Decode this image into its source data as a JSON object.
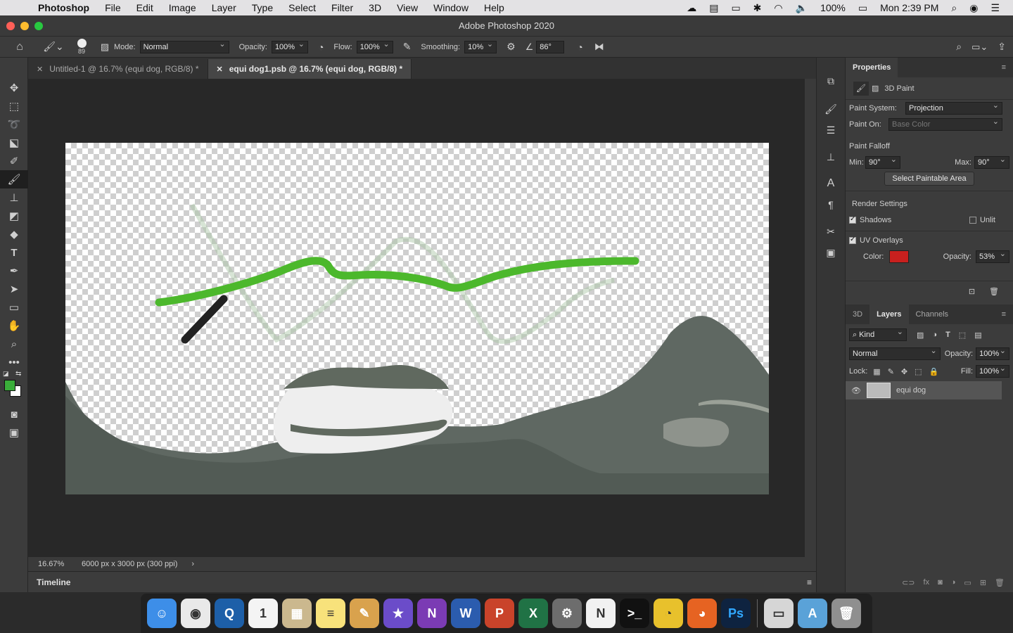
{
  "menubar": {
    "app_name": "Photoshop",
    "items": [
      "File",
      "Edit",
      "Image",
      "Layer",
      "Type",
      "Select",
      "Filter",
      "3D",
      "View",
      "Window",
      "Help"
    ],
    "battery": "100%",
    "clock": "Mon 2:39 PM"
  },
  "window": {
    "title": "Adobe Photoshop 2020"
  },
  "options": {
    "brush_size": "89",
    "mode_label": "Mode:",
    "mode_value": "Normal",
    "opacity_label": "Opacity:",
    "opacity_value": "100%",
    "flow_label": "Flow:",
    "flow_value": "100%",
    "smoothing_label": "Smoothing:",
    "smoothing_value": "10%",
    "angle_value": "86°"
  },
  "tabs": [
    {
      "label": "Untitled-1 @ 16.7% (equi dog, RGB/8) *"
    },
    {
      "label": "equi dog1.psb @ 16.7% (equi dog, RGB/8) *"
    }
  ],
  "status": {
    "zoom": "16.67%",
    "doc_size": "6000 px x 3000 px (300 ppi)"
  },
  "timeline": {
    "label": "Timeline"
  },
  "colors": {
    "foreground": "#3aae3a",
    "background": "#ffffff",
    "uv_overlay": "#c8201e",
    "stroke_green": "#4cb82c",
    "stroke_black": "#222222"
  },
  "properties": {
    "title": "Properties",
    "section": "3D Paint",
    "paint_system_label": "Paint System:",
    "paint_system_value": "Projection",
    "paint_on_label": "Paint On:",
    "paint_on_value": "Base Color",
    "falloff_label": "Paint Falloff",
    "min_label": "Min:",
    "min_value": "90°",
    "max_label": "Max:",
    "max_value": "90°",
    "select_button": "Select Paintable Area",
    "render_label": "Render Settings",
    "shadows_label": "Shadows",
    "unlit_label": "Unlit",
    "uv_label": "UV Overlays",
    "color_label": "Color:",
    "opacity_label": "Opacity:",
    "opacity_value": "53%"
  },
  "layers": {
    "tabs": [
      "3D",
      "Layers",
      "Channels"
    ],
    "filter_kind": "Kind",
    "blend_mode": "Normal",
    "opacity_label": "Opacity:",
    "opacity_value": "100%",
    "lock_label": "Lock:",
    "fill_label": "Fill:",
    "fill_value": "100%",
    "items": [
      {
        "name": "equi dog"
      }
    ]
  },
  "dock": {
    "apps": [
      {
        "name": "Finder",
        "color": "#3d8ee8",
        "glyph": "☺"
      },
      {
        "name": "Chrome",
        "color": "#e9e9e9",
        "glyph": "◉"
      },
      {
        "name": "Quicktime",
        "color": "#1d5fa8",
        "glyph": "Q"
      },
      {
        "name": "Calendar",
        "color": "#f4f4f4",
        "glyph": "1"
      },
      {
        "name": "Keynote",
        "color": "#cbb88e",
        "glyph": "▦"
      },
      {
        "name": "Notes",
        "color": "#f8e27b",
        "glyph": "≡"
      },
      {
        "name": "Paint",
        "color": "#d9a24d",
        "glyph": "✎"
      },
      {
        "name": "iMovie",
        "color": "#6b4cc9",
        "glyph": "★"
      },
      {
        "name": "OneNote",
        "color": "#7b3bb4",
        "glyph": "N"
      },
      {
        "name": "Word",
        "color": "#2b5cae",
        "glyph": "W"
      },
      {
        "name": "PowerPoint",
        "color": "#c9432a",
        "glyph": "P"
      },
      {
        "name": "Excel",
        "color": "#207245",
        "glyph": "X"
      },
      {
        "name": "System Preferences",
        "color": "#6d6d6d",
        "glyph": "⚙"
      },
      {
        "name": "News",
        "color": "#f1f1f1",
        "glyph": "N"
      },
      {
        "name": "Terminal",
        "color": "#111111",
        "glyph": ">_"
      },
      {
        "name": "Cyberduck",
        "color": "#e8c12c",
        "glyph": "◔"
      },
      {
        "name": "Firefox",
        "color": "#e66322",
        "glyph": "◕"
      },
      {
        "name": "Photoshop",
        "color": "#0e2340",
        "glyph": "Ps"
      },
      {
        "name": "Drive",
        "color": "#d6d6d6",
        "glyph": "▭"
      },
      {
        "name": "Applications",
        "color": "#5aa2d8",
        "glyph": "A"
      },
      {
        "name": "Trash",
        "color": "#8f8f8f",
        "glyph": "🗑"
      }
    ]
  }
}
